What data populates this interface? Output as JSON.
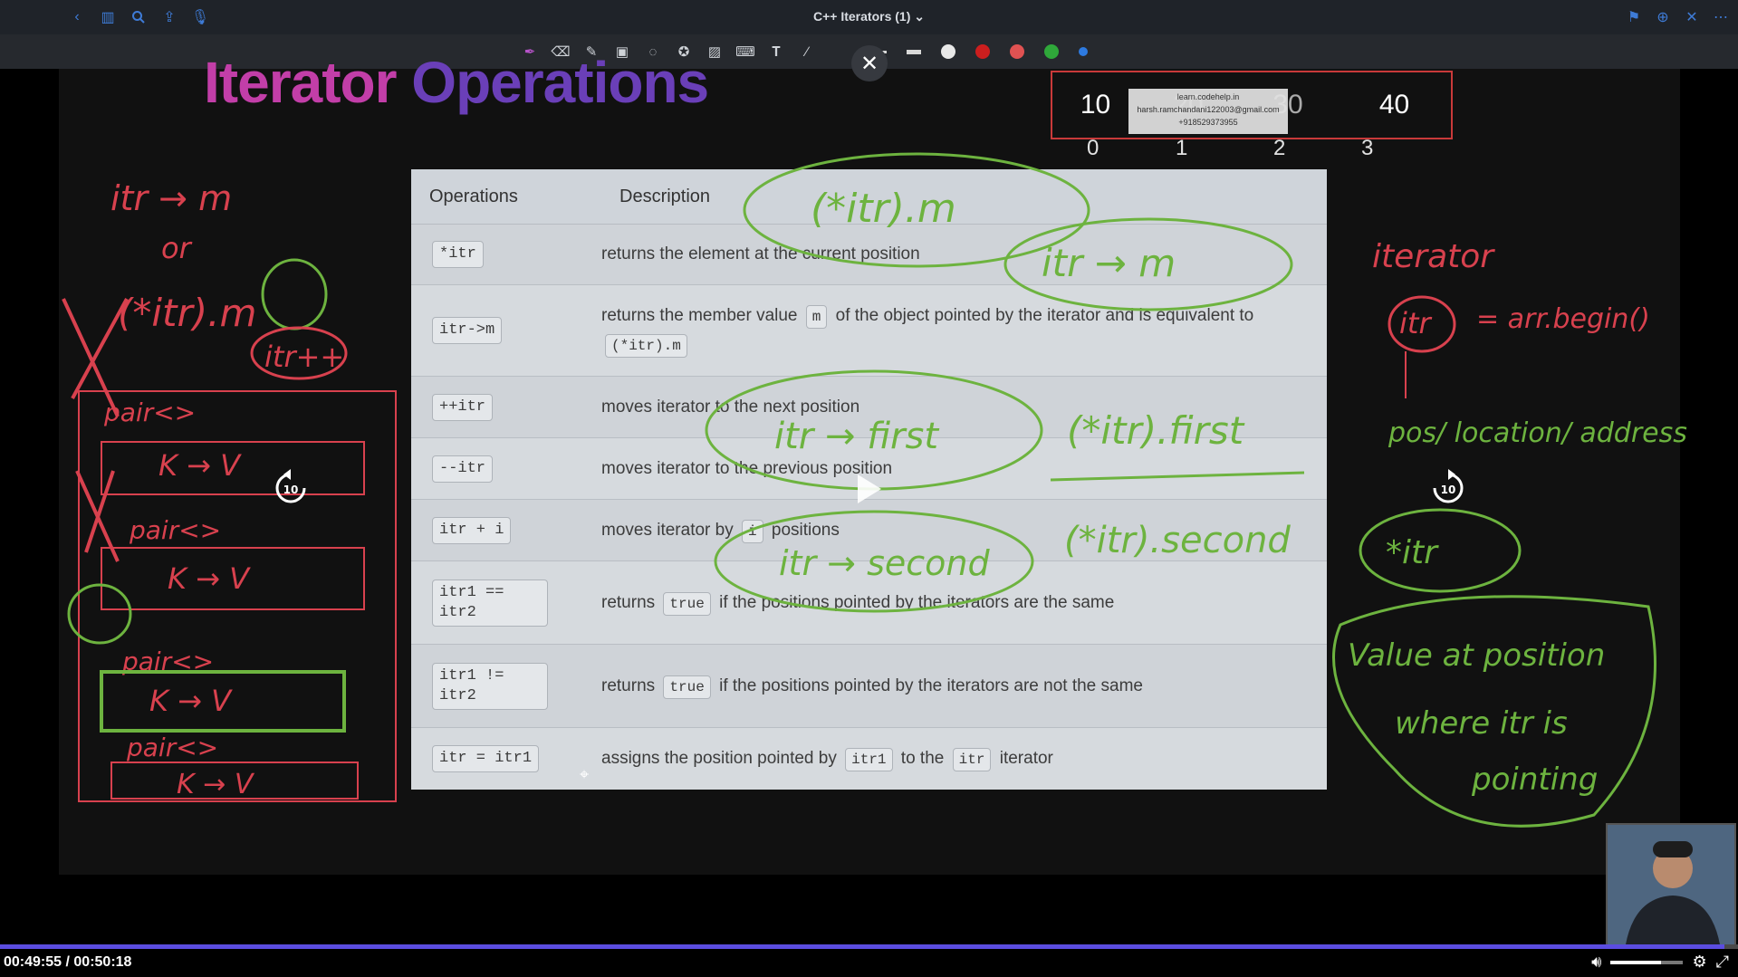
{
  "window": {
    "title": "C++ Iterators",
    "count": "(1)",
    "nav_icons": [
      "back-chevron-icon",
      "sidebar-icon",
      "search-icon",
      "share-icon",
      "microphone-icon"
    ],
    "right_icons": [
      "bookmark-icon",
      "add-page-icon",
      "close-icon",
      "more-icon"
    ]
  },
  "toolbar": {
    "tools": [
      "pen-icon",
      "eraser-icon",
      "highlighter-icon",
      "shapes-icon",
      "lasso-icon",
      "star-icon",
      "image-icon",
      "keyboard-icon",
      "text-box-icon",
      "laser-icon"
    ],
    "colors": [
      "#cc1e1e",
      "#e05252",
      "#2fa83a",
      "#2d7ae0"
    ]
  },
  "slide": {
    "title_part1": "Iterator",
    "title_part2": "Operations",
    "table": {
      "headers": [
        "Operations",
        "Description"
      ],
      "rows": [
        {
          "op": "*itr",
          "desc": [
            "returns the element at the current position"
          ]
        },
        {
          "op": "itr->m",
          "desc": [
            "returns the member value ",
            "m",
            " of the object  pointed by the iterator and is equivalent to ",
            "(*itr).m"
          ]
        },
        {
          "op": "++itr",
          "desc": [
            "moves iterator to the next position"
          ]
        },
        {
          "op": "--itr",
          "desc": [
            "moves iterator to the previous position"
          ]
        },
        {
          "op": "itr + i",
          "desc": [
            "moves iterator by ",
            "i",
            " positions"
          ]
        },
        {
          "op": "itr1 == itr2",
          "desc": [
            "returns ",
            "true",
            " if the positions pointed by the iterators are the same"
          ]
        },
        {
          "op": "itr1 != itr2",
          "desc": [
            "returns ",
            "true",
            " if the positions pointed by the iterators are not the same"
          ]
        },
        {
          "op": "itr = itr1",
          "desc": [
            "assigns the position pointed by ",
            "itr1",
            " to the ",
            "itr",
            " iterator"
          ]
        }
      ]
    },
    "array_cells": [
      "10",
      "20",
      "30",
      "40"
    ],
    "array_indices": [
      "0",
      "1",
      "2",
      "3"
    ],
    "watermark": [
      "learn.codehelp.in",
      "harsh.ramchandani122003@gmail.com",
      "+918529373955"
    ],
    "annotations": {
      "left_1": "itr → m",
      "left_or": "or",
      "left_2": "(*itr).m",
      "left_inc": "itr++",
      "pair": "pair<>",
      "kv": "K → V",
      "mid_1": "(*itr).m",
      "mid_2": "itr → m",
      "mid_3": "itr → first",
      "mid_4": "(*itr).first",
      "mid_5": "itr → second",
      "mid_6": "(*itr).second",
      "right_iterator": "iterator",
      "right_itr": "itr",
      "right_eq": "= arr.begin()",
      "right_pos": "pos/ location/ address",
      "right_deref": "*itr",
      "right_value": [
        "Value at position",
        "where itr is",
        "pointing"
      ]
    }
  },
  "player": {
    "current_time": "00:49:55",
    "total_time": "/ 00:50:18",
    "progress": 0.992,
    "skip_back": "10",
    "skip_forward": "10",
    "volume": 0.7
  }
}
